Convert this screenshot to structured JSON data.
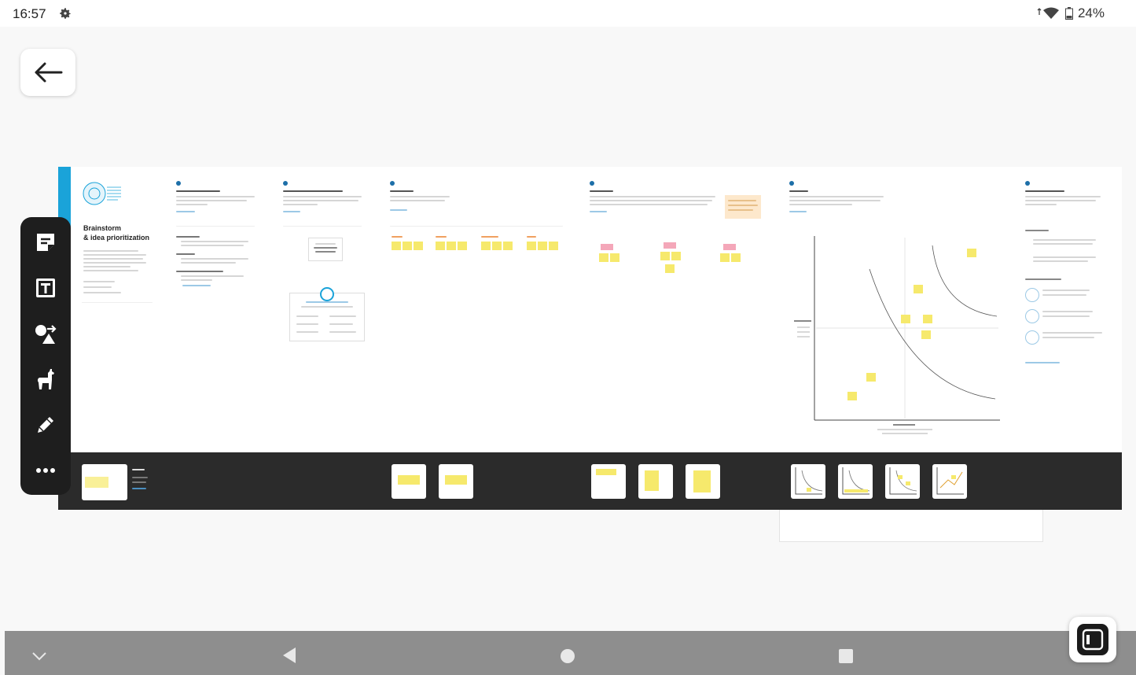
{
  "status": {
    "time": "16:57",
    "battery": "24%"
  },
  "board": {
    "intro_title_line1": "Brainstorm",
    "intro_title_line2": "& idea prioritization"
  },
  "icons": {
    "gear": "gear-icon",
    "wifi": "wifi-icon",
    "battery": "battery-icon",
    "back": "arrow-left-icon",
    "sticky_note": "sticky-note-icon",
    "text": "text-icon",
    "shapes": "shapes-icon",
    "llama": "llama-icon",
    "pen": "pen-icon",
    "more": "more-icon",
    "collapse": "chevron-down-icon",
    "nav_back": "nav-back-icon",
    "nav_home": "nav-home-icon",
    "nav_recents": "nav-recents-icon",
    "fab": "widget-icon"
  },
  "colors": {
    "accent_blue": "#1aa3d9",
    "toolbar_bg": "#1e1e1e",
    "band_bg": "#2b2b2b",
    "sticky_yellow": "#f6e96c",
    "sticky_pink": "#f4a7b9"
  }
}
